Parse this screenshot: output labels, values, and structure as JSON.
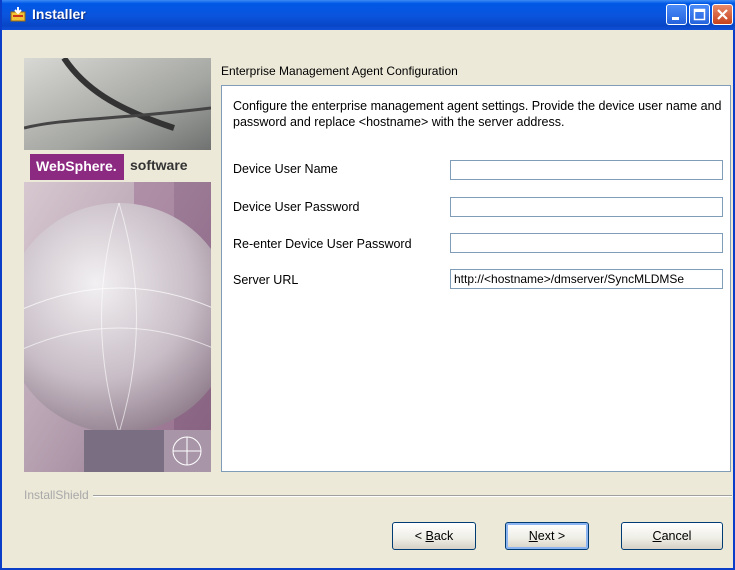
{
  "window": {
    "title": "Installer",
    "controls": [
      "minimize",
      "maximize",
      "close"
    ]
  },
  "sidebar": {
    "brand_name": "WebSphere.",
    "brand_suffix": "software"
  },
  "page": {
    "section_title": "Enterprise Management Agent Configuration",
    "description": "Configure the enterprise management agent settings. Provide the device user name and password and replace <hostname> with the server address.",
    "fields": [
      {
        "label": "Device User Name",
        "value": "",
        "type": "text"
      },
      {
        "label": "Device User Password",
        "value": "",
        "type": "password"
      },
      {
        "label": "Re-enter Device User Password",
        "value": "",
        "type": "password"
      },
      {
        "label": "Server URL",
        "value": "http://<hostname>/dmserver/SyncMLDMSe",
        "type": "text"
      }
    ]
  },
  "footer": {
    "installshield_label": "InstallShield",
    "buttons": {
      "back": {
        "pre": "< ",
        "mnemonic": "B",
        "post": "ack"
      },
      "next": {
        "pre": "",
        "mnemonic": "N",
        "post": "ext >"
      },
      "cancel": {
        "pre": "",
        "mnemonic": "C",
        "post": "ancel"
      }
    }
  },
  "colors": {
    "titlebar": "#0A55DE",
    "window_bg": "#ECE9D8",
    "brand_bar": "#8C2A82"
  }
}
